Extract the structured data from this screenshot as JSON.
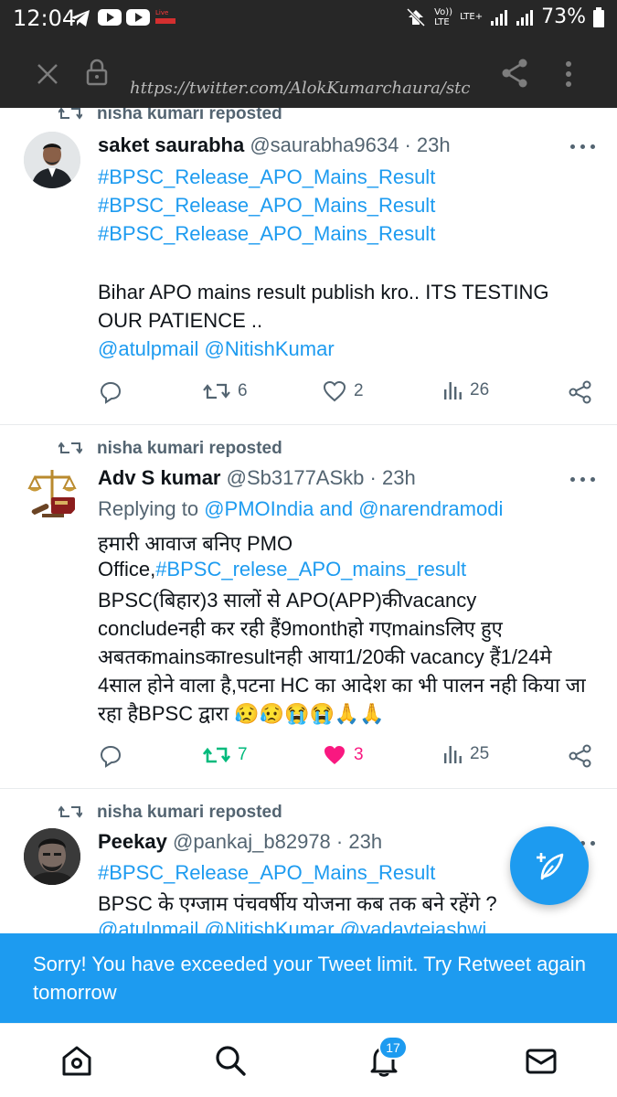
{
  "status_bar": {
    "time": "12:04",
    "network_label_1": "Vo))",
    "network_label_2": "LTE",
    "lte_plus": "LTE+",
    "battery": "73%",
    "live_label": "Live"
  },
  "browser": {
    "url": "https://twitter.com/AlokKumarchaura/stc"
  },
  "tweets": [
    {
      "repost_label": "nisha kumari reposted",
      "name": "saket saurabha",
      "handle": "@saurabha9634",
      "dot": "·",
      "time": "23h",
      "lines": [
        "#BPSC_Release_APO_Mains_Result",
        "#BPSC_Release_APO_Mains_Result",
        "#BPSC_Release_APO_Mains_Result",
        "Bihar APO  mains result publish kro.. ITS TESTING",
        "OUR PATIENCE .."
      ],
      "mentions": [
        "@atulpmail",
        "@NitishKumar"
      ],
      "replies": "",
      "retweets": "6",
      "likes": "2",
      "views": "26"
    },
    {
      "repost_label": "nisha kumari reposted",
      "name": "Adv S kumar",
      "handle": "@Sb3177ASkb",
      "dot": "·",
      "time": "23h",
      "replying_prefix": "Replying to ",
      "replying_to": "@PMOIndia and @narendramodi",
      "lines": [
        "हमारी आवाज बनिए PMO",
        "Office,",
        "#BPSC_relese_APO_mains_result",
        "BPSC(बिहार)3 सालों से APO(APP)कीvacancy",
        "concludeनही कर रही हैं9monthहो गएmainsलिए हुए",
        "अबतकmainsकाresultनही आया1/20की vacancy हैं1/24मे",
        "4साल होने वाला है,पटना HC का आदेश का भी पालन नही किया जा",
        "रहा हैBPSC द्वारा 😥😥😭😭🙏🙏"
      ],
      "replies": "",
      "retweets": "7",
      "likes": "3",
      "views": "25"
    },
    {
      "repost_label": "nisha kumari reposted",
      "name": "Peekay",
      "handle": "@pankaj_b82978",
      "dot": "·",
      "time": "23h",
      "lines": [
        "#BPSC_Release_APO_Mains_Result",
        "BPSC के एग्जाम पंचवर्षीय योजना कब तक बने रहेंगे ?",
        "@atulpmail @NitishKumar @yadavtejashwi"
      ]
    }
  ],
  "toast": {
    "message": "Sorry! You have exceeded your Tweet limit. Try Retweet again tomorrow"
  },
  "bottom_nav": {
    "notifications_badge": "17"
  },
  "colors": {
    "accent": "#1d9bf0",
    "retweet_active": "#00ba7c",
    "like_active": "#f91880",
    "muted_text": "#536471",
    "status_bar_bg": "#272727"
  },
  "icons": [
    "telegram-icon",
    "youtube-icon",
    "close-icon",
    "lock-icon",
    "share-icon",
    "more-vert-icon",
    "retweet-icon",
    "reply-icon",
    "heart-icon",
    "views-icon",
    "share-tweet-icon",
    "compose-icon",
    "home-icon",
    "search-icon",
    "bell-icon",
    "mail-icon"
  ]
}
